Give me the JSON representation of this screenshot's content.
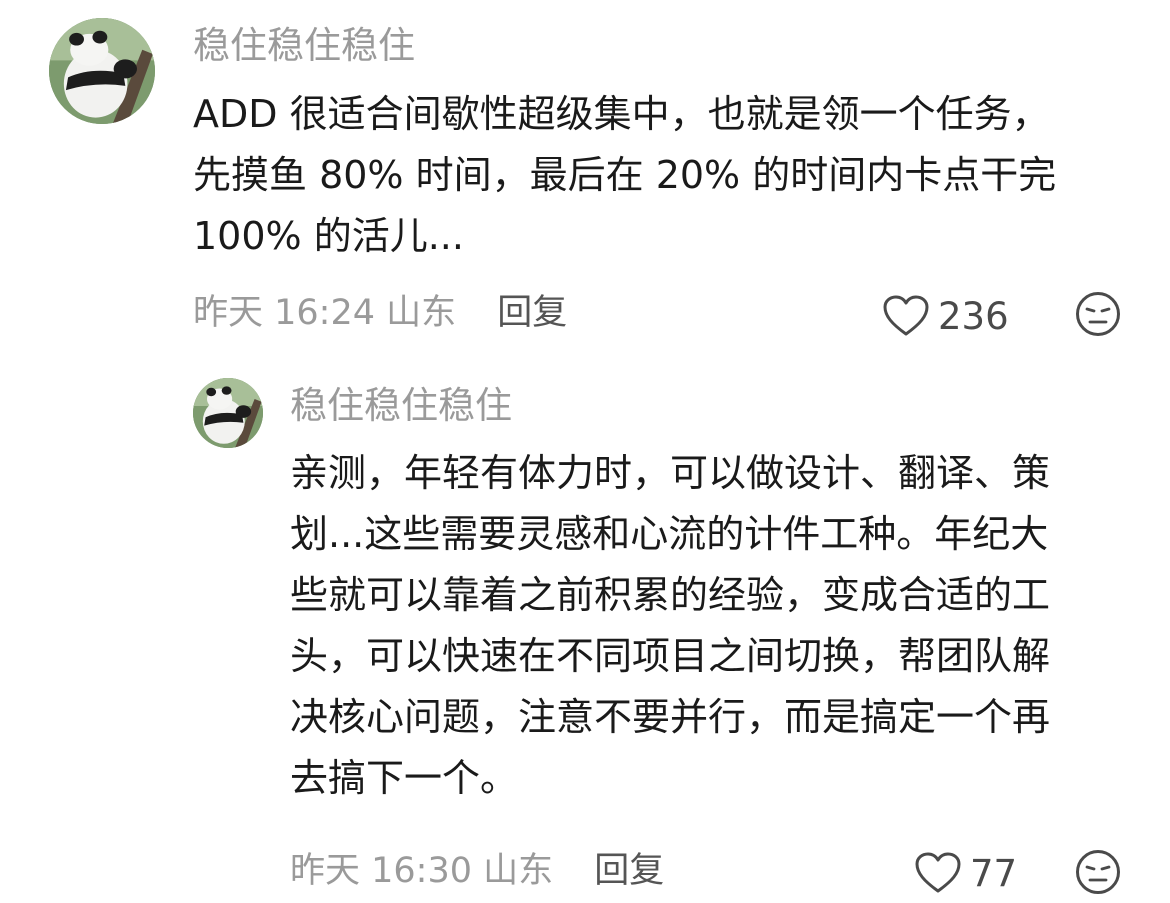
{
  "comment": {
    "username": "稳住稳住稳住",
    "avatar_icon": "panda-avatar-icon",
    "lines": [
      "ADD 很适合间歇性超级集中，也就是领一个任务，",
      "先摸鱼 80% 时间，最后在 20% 的时间内卡点干完",
      "100% 的活儿..."
    ],
    "time": "昨天 16:24",
    "location": "山东",
    "reply_label": "回复",
    "like_count": "236"
  },
  "reply": {
    "username": "稳住稳住稳住",
    "avatar_icon": "panda-avatar-icon",
    "lines": [
      "亲测，年轻有体力时，可以做设计、翻译、策",
      "划...这些需要灵感和心流的计件工种。年纪大",
      "些就可以靠着之前积累的经验，变成合适的工",
      "头，可以快速在不同项目之间切换，帮团队解",
      "决核心问题，注意不要并行，而是搞定一个再",
      "去搞下一个。"
    ],
    "time": "昨天 16:30",
    "location": "山东",
    "reply_label": "回复",
    "like_count": "77"
  },
  "colors": {
    "text": "#1a1a1a",
    "muted": "#9a9a9a",
    "icon": "#4a4a4a"
  }
}
